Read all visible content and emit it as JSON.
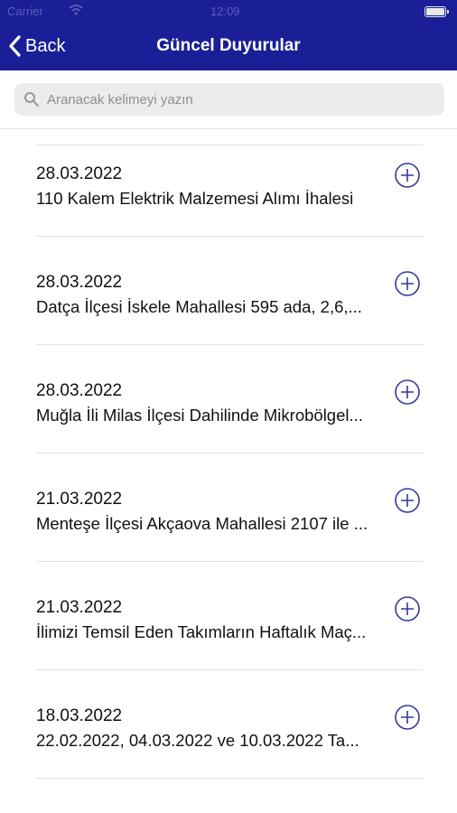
{
  "status_bar": {
    "carrier": "Carrier",
    "time": "12:09"
  },
  "nav": {
    "back_label": "Back",
    "title": "Güncel Duyurular"
  },
  "search": {
    "placeholder": "Aranacak kelimeyi yazın",
    "value": ""
  },
  "colors": {
    "nav_background": "#1a1f97",
    "add_icon": "#35399a"
  },
  "icons": {
    "back": "chevron-left-icon",
    "search": "magnifier-icon",
    "add": "plus-circle-icon"
  },
  "announcements": [
    {
      "date": "28.03.2022",
      "title": "110 Kalem Elektrik Malzemesi Alımı İhalesi"
    },
    {
      "date": "28.03.2022",
      "title": "Datça İlçesi İskele Mahallesi 595 ada, 2,6,..."
    },
    {
      "date": "28.03.2022",
      "title": "Muğla İli Milas İlçesi Dahilinde Mikrobölgel..."
    },
    {
      "date": "21.03.2022",
      "title": "Menteşe İlçesi Akçaova Mahallesi 2107 ile ..."
    },
    {
      "date": "21.03.2022",
      "title": "İlimizi Temsil Eden Takımların Haftalık Maç..."
    },
    {
      "date": "18.03.2022",
      "title": "22.02.2022, 04.03.2022 ve 10.03.2022 Ta..."
    }
  ]
}
